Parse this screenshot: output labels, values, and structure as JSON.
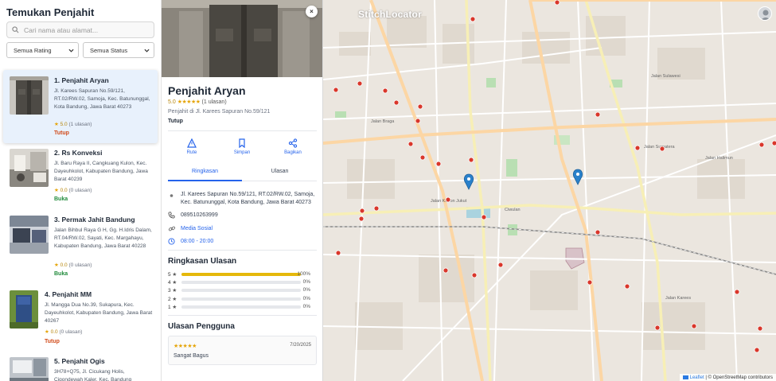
{
  "sidebar": {
    "title": "Temukan Penjahit",
    "search_placeholder": "Cari nama atau alamat...",
    "filter_rating": "Semua Rating",
    "filter_status": "Semua Status"
  },
  "tailors": [
    {
      "name": "1. Penjahit Aryan",
      "address": "Jl. Karees Sapuran No.59/121, RT.02/RW.02, Samoja, Kec. Batununggal, Kota Bandung, Jawa Barat 40273",
      "score": "5.0",
      "reviews": "(1 ulasan)",
      "status": "Tutup"
    },
    {
      "name": "2. Rs Konveksi",
      "address": "Jl. Baru Raya II, Cangkuang Kulon, Kec. Dayeuhkolot, Kabupaten Bandung, Jawa Barat 40239",
      "score": "0.0",
      "reviews": "(0 ulasan)",
      "status": "Buka"
    },
    {
      "name": "3. Permak Jahit Bandung",
      "address": "Jalan Bihbul Raya G H, Gg. H.Idris Dalam, RT.04/RW.02, Sayati, Kec. Margahayu, Kabupaten Bandung, Jawa Barat 40228",
      "score": "0.0",
      "reviews": "(0 ulasan)",
      "status": "Buka"
    },
    {
      "name": "4. Penjahit MM",
      "address": "Jl. Mangga Dua No.39, Sukapura, Kec. Dayeuhkolot, Kabupaten Bandung, Jawa Barat 40267",
      "score": "0.0",
      "reviews": "(0 ulasan)",
      "status": "Tutup"
    },
    {
      "name": "5. Penjahit Ogis",
      "address": "3H78+Q75, Jl. Cicukang Holis, Cigondewah Kaler, Kec. Bandung",
      "score": "",
      "reviews": "",
      "status": ""
    }
  ],
  "detail": {
    "close_label": "×",
    "name": "Penjahit Aryan",
    "score": "5.0",
    "stars": "★★★★★",
    "reviews": "(1 ulasan)",
    "subtitle": "Penjahit di Jl. Karees Sapuran No.59/121",
    "status": "Tutup",
    "actions": {
      "route": "Rute",
      "save": "Simpan",
      "share": "Bagikan"
    },
    "tabs": {
      "summary": "Ringkasan",
      "reviews": "Ulasan"
    },
    "address": "Jl. Karees Sapuran No.59/121, RT.02/RW.02, Samoja, Kec. Batununggal, Kota Bandung, Jawa Barat 40273",
    "phone": "089510263999",
    "social": "Media Sosial",
    "hours": "08:00 - 20:00",
    "summary_title": "Ringkasan Ulasan",
    "distribution": [
      {
        "label": "5",
        "pct": "100%",
        "value": 1.0
      },
      {
        "label": "4",
        "pct": "0%",
        "value": 0
      },
      {
        "label": "3",
        "pct": "0%",
        "value": 0
      },
      {
        "label": "2",
        "pct": "0%",
        "value": 0
      },
      {
        "label": "1",
        "pct": "0%",
        "value": 0
      }
    ],
    "user_reviews_title": "Ulasan Pengguna",
    "review": {
      "stars": "★★★★★",
      "date": "7/20/2025",
      "text": "Sangat Bagus"
    }
  },
  "map": {
    "title": "StitchLocator",
    "attribution_leaflet": "Leaflet",
    "attribution_rest": "| © OpenStreetMap contributors",
    "colors": {
      "accent": "#2563eb",
      "marker": "#2a81cb",
      "poi": "#c21a1a",
      "star": "#e5a50a"
    }
  }
}
